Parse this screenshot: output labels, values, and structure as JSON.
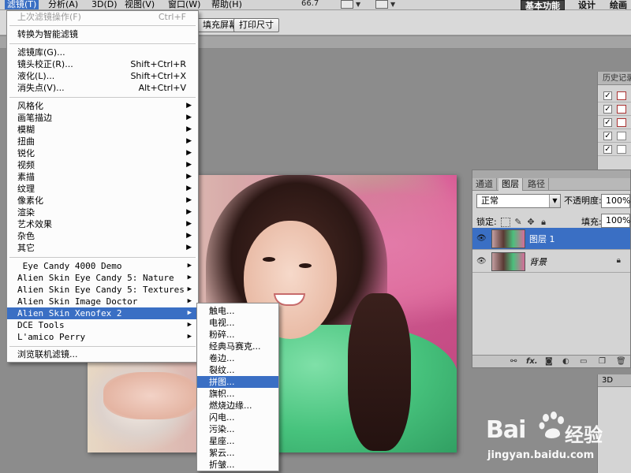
{
  "menubar": {
    "items": [
      "滤镜(T)",
      "分析(A)",
      "3D(D)",
      "视图(V)",
      "窗口(W)",
      "帮助(H)"
    ],
    "zoom": "66.7",
    "workspaces": [
      "基本功能",
      "设计",
      "绘画"
    ]
  },
  "optbar": {
    "buttons": [
      "填充屏幕",
      "打印尺寸"
    ]
  },
  "filter_menu": {
    "last_filter": {
      "label": "上次滤镜操作(F)",
      "shortcut": "Ctrl+F"
    },
    "smart": "转换为智能滤镜",
    "group1": [
      {
        "label": "滤镜库(G)...",
        "shortcut": ""
      },
      {
        "label": "镜头校正(R)...",
        "shortcut": "Shift+Ctrl+R"
      },
      {
        "label": "液化(L)...",
        "shortcut": "Shift+Ctrl+X"
      },
      {
        "label": "消失点(V)...",
        "shortcut": "Alt+Ctrl+V"
      }
    ],
    "group2": [
      "风格化",
      "画笔描边",
      "模糊",
      "扭曲",
      "锐化",
      "视频",
      "素描",
      "纹理",
      "像素化",
      "渲染",
      "艺术效果",
      "杂色",
      "其它"
    ],
    "group3": [
      " Eye Candy 4000 Demo",
      "Alien Skin Eye Candy 5: Nature",
      "Alien Skin Eye Candy 5: Textures",
      "Alien Skin Image Doctor",
      "Alien Skin Xenofex 2",
      "DCE Tools",
      "L'amico Perry"
    ],
    "browse": "浏览联机滤镜..."
  },
  "xenofex_submenu": {
    "items": [
      "触电...",
      "电视...",
      "粉碎...",
      "经典马赛克...",
      "卷边...",
      "裂纹...",
      "拼图...",
      "旗帜...",
      "燃烧边缘...",
      "闪电...",
      "污染...",
      "星座...",
      "絮云...",
      "折皱..."
    ],
    "highlighted": "拼图..."
  },
  "history_panel": {
    "title": "历史记录"
  },
  "layers_panel": {
    "tabs": [
      "通道",
      "图层",
      "路径"
    ],
    "active_tab": "图层",
    "blend_mode": "正常",
    "opacity_label": "不透明度:",
    "opacity_value": "100%",
    "lock_label": "锁定:",
    "fill_label": "填充:",
    "fill_value": "100%",
    "layers": [
      {
        "name": "图层 1",
        "selected": true
      },
      {
        "name": "背景",
        "selected": false
      }
    ]
  },
  "threeD_panel": {
    "title": "3D"
  },
  "watermark": {
    "brand": "Bai",
    "cn": "经验",
    "url": "jingyan.baidu.com"
  }
}
